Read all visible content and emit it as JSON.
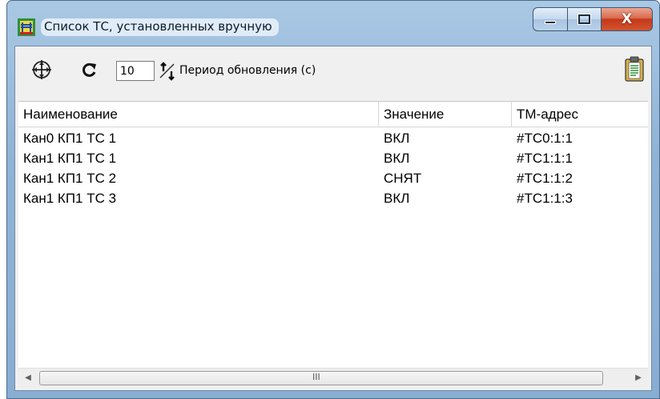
{
  "window": {
    "title": "Список ТС, установленных вручную",
    "caption_close_glyph": "X"
  },
  "toolbar": {
    "period_value": "10",
    "period_label": "Период обновления (с)",
    "icons": [
      "target-icon",
      "refresh-icon",
      "spin-arrows-icon",
      "clipboard-icon"
    ]
  },
  "table": {
    "columns": [
      "Наименование",
      "Значение",
      "ТМ-адрес"
    ],
    "rows": [
      {
        "name": "Кан0 КП1 ТС 1",
        "value": "ВКЛ",
        "address": "#TC0:1:1"
      },
      {
        "name": "Кан1 КП1 ТС 1",
        "value": "ВКЛ",
        "address": "#TC1:1:1"
      },
      {
        "name": "Кан1 КП1 ТС 2",
        "value": "СНЯТ",
        "address": "#TC1:1:2"
      },
      {
        "name": "Кан1 КП1 ТС 3",
        "value": "ВКЛ",
        "address": "#TC1:1:3"
      }
    ]
  },
  "scrollbar": {
    "grip": "III",
    "left_arrow": "◀",
    "right_arrow": "▶"
  },
  "colors": {
    "titlebar": "#8fb3d6",
    "close_button": "#c4381a",
    "background": "#f0f0f0"
  }
}
